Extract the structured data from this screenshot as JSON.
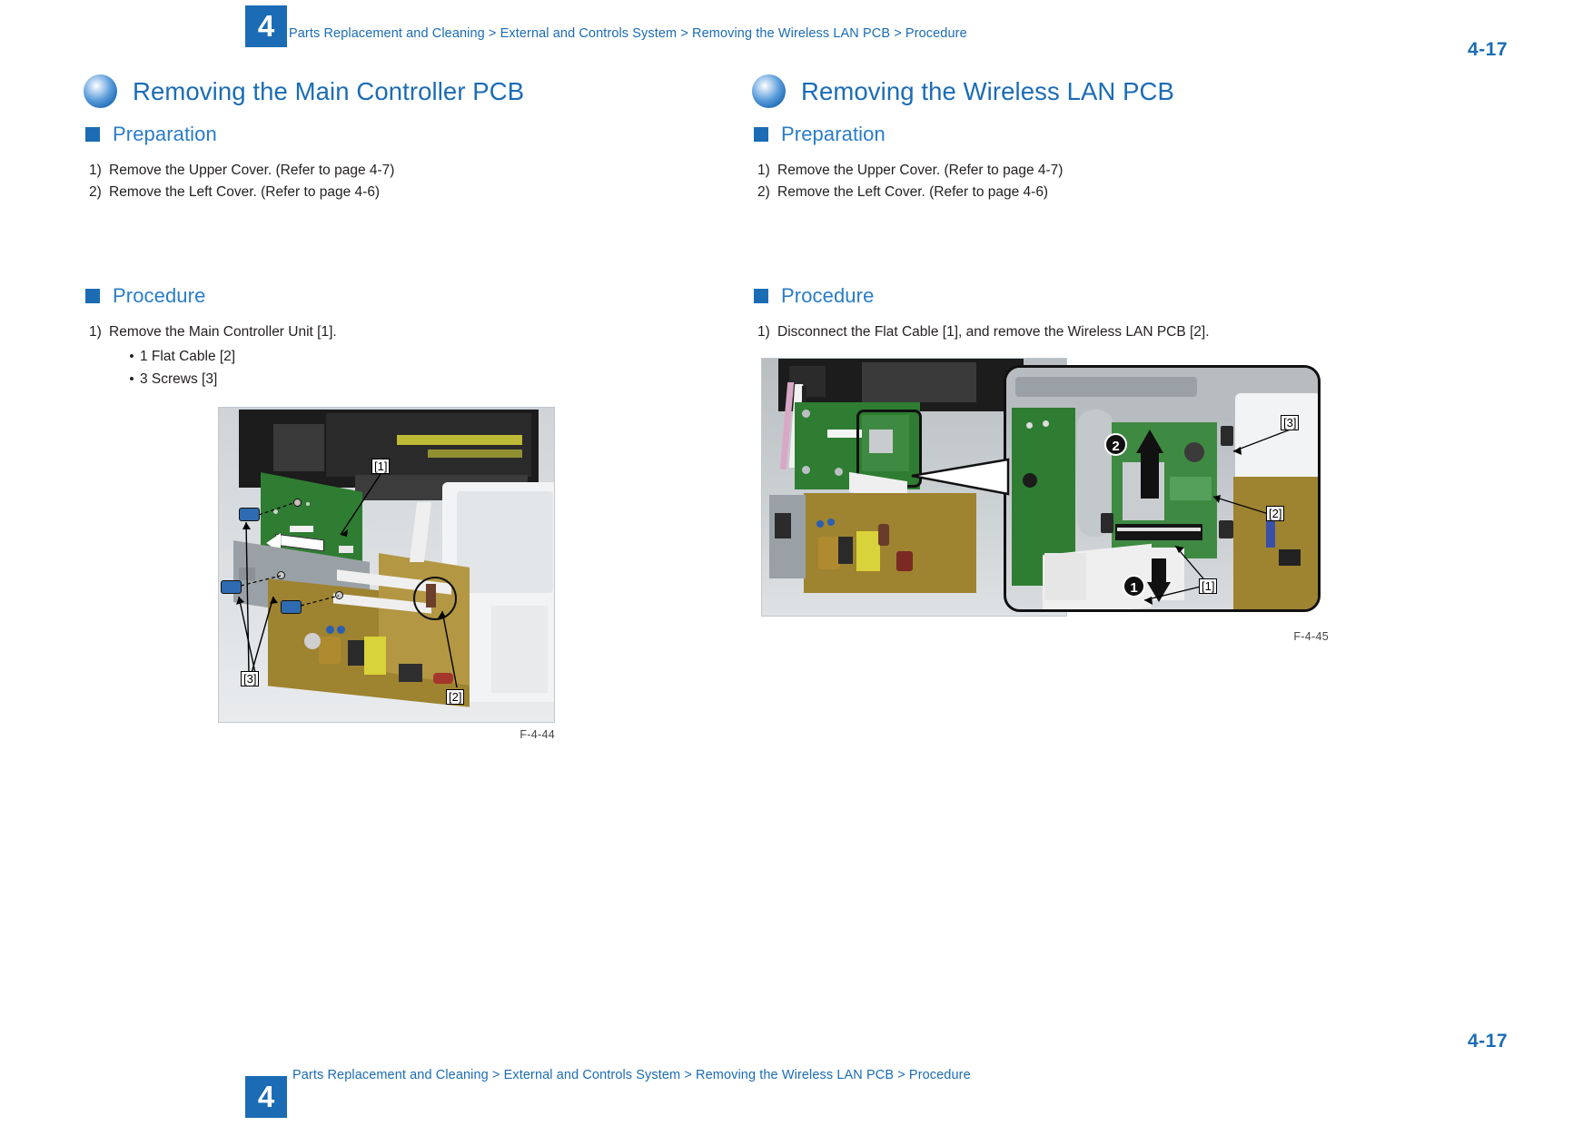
{
  "header": {
    "chapter_number": "4",
    "breadcrumb": "Parts Replacement and Cleaning > External and Controls System > Removing the Wireless LAN PCB > Procedure",
    "page_number": "4-17"
  },
  "footer": {
    "chapter_number": "4",
    "breadcrumb": "Parts Replacement and Cleaning > External and Controls System > Removing the Wireless LAN PCB > Procedure",
    "page_number": "4-17"
  },
  "colors": {
    "accent_blue": "#1b6cb5",
    "heading_blue": "#2a7cc7",
    "body_text": "#231f20"
  },
  "left_column": {
    "title": "Removing the Main Controller PCB",
    "preparation": {
      "heading": "Preparation",
      "steps": [
        {
          "num": "1)",
          "text": "Remove the Upper Cover. (Refer to page 4-7)"
        },
        {
          "num": "2)",
          "text": "Remove the Left Cover. (Refer to page 4-6)"
        }
      ]
    },
    "procedure": {
      "heading": "Procedure",
      "steps": [
        {
          "num": "1)",
          "text": "Remove the Main Controller Unit [1]."
        }
      ],
      "bullets": [
        {
          "dot": "•",
          "text": "1 Flat Cable [2]"
        },
        {
          "dot": "•",
          "text": "3 Screws [3]"
        }
      ]
    },
    "figure": {
      "caption": "F-4-44",
      "callouts": [
        "[1]",
        "[2]",
        "[3]"
      ],
      "description": "Photo of printer chassis with the Main Controller PCB, flat cable and three screws indicated"
    }
  },
  "right_column": {
    "title": "Removing the Wireless LAN PCB",
    "preparation": {
      "heading": "Preparation",
      "steps": [
        {
          "num": "1)",
          "text": "Remove the Upper Cover. (Refer to page 4-7)"
        },
        {
          "num": "2)",
          "text": "Remove the Left Cover. (Refer to page 4-6)"
        }
      ]
    },
    "procedure": {
      "heading": "Procedure",
      "steps": [
        {
          "num": "1)",
          "text": "Disconnect the Flat Cable [1], and remove the Wireless LAN PCB [2]."
        }
      ]
    },
    "figure": {
      "caption": "F-4-45",
      "callouts": [
        "[1]",
        "[2]",
        "[3]"
      ],
      "step_markers": [
        "1",
        "2"
      ],
      "description": "Photo of printer interior with magnified inset showing the Wireless LAN PCB, flat cable connector and retaining claw"
    }
  },
  "icons": {
    "sphere_bullet": "blue-sphere-bullet-icon",
    "square_bullet": "blue-square-bullet-icon",
    "screw": "screw-icon"
  }
}
